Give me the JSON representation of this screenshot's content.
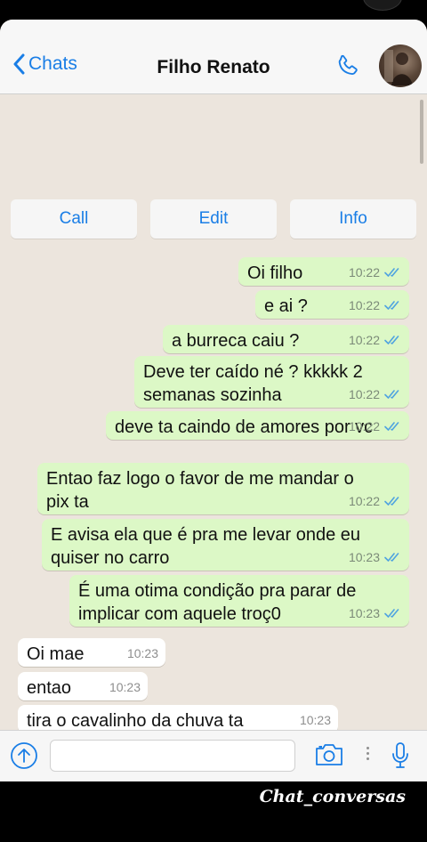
{
  "header": {
    "back_label": "Chats",
    "contact_name": "Filho Renato"
  },
  "actions": {
    "call": "Call",
    "edit": "Edit",
    "info": "Info"
  },
  "messages": [
    {
      "text": "Oi filho",
      "time": "10:22",
      "dir": "out"
    },
    {
      "text": "e ai ?",
      "time": "10:22",
      "dir": "out"
    },
    {
      "text": "a burreca caiu ?",
      "time": "10:22",
      "dir": "out"
    },
    {
      "text": "Deve ter caído né ? kkkkk 2\nsemanas sozinha",
      "time": "10:22",
      "dir": "out"
    },
    {
      "text": "deve ta caindo de amores por vc",
      "time": "10:22",
      "dir": "out"
    },
    {
      "text": "Entao faz logo o favor de me mandar o\npix ta",
      "time": "10:22",
      "dir": "out"
    },
    {
      "text": "E avisa ela que é pra me levar onde eu\nquiser no carro",
      "time": "10:23",
      "dir": "out"
    },
    {
      "text": "É uma otima condição pra parar de\nimplicar com aquele troç0",
      "time": "10:23",
      "dir": "out"
    },
    {
      "text": "Oi mae",
      "time": "10:23",
      "dir": "in"
    },
    {
      "text": "entao",
      "time": "10:23",
      "dir": "in"
    },
    {
      "text": "tira o cavalinho da chuva ta",
      "time": "10:23",
      "dir": "in"
    }
  ],
  "input": {
    "placeholder": ""
  },
  "watermark": "Chat_conversas",
  "colors": {
    "accent": "#1a7ee6",
    "outgoing_bubble": "#dcf8c6",
    "incoming_bubble": "#ffffff",
    "chat_background": "#ece5dd",
    "read_ticks": "#4fa3e0"
  },
  "icons": [
    "chevron-left-icon",
    "phone-icon",
    "upload-arrow-icon",
    "camera-icon",
    "more-dots-icon",
    "microphone-icon",
    "double-check-icon"
  ]
}
